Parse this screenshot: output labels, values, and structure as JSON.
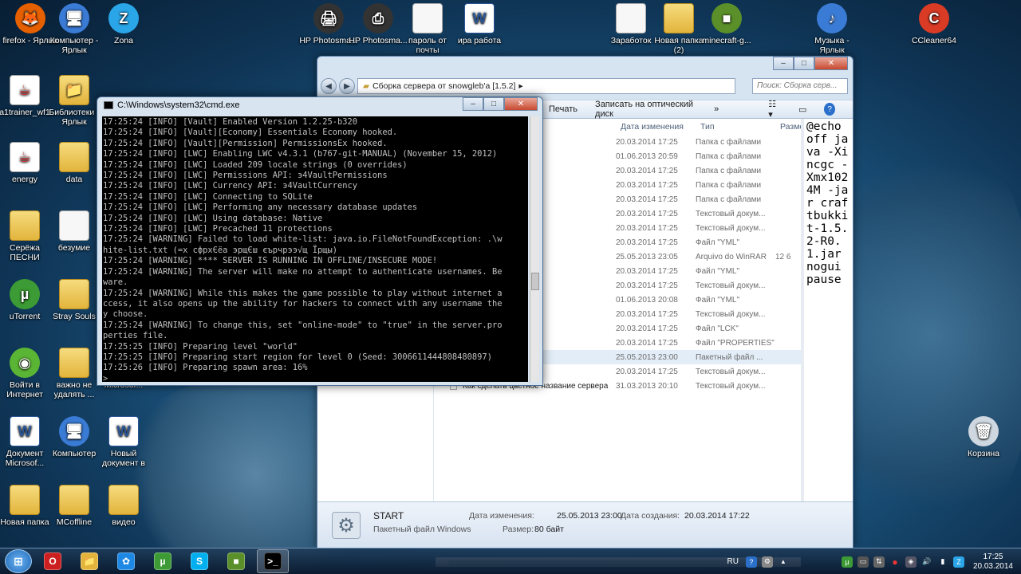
{
  "desktop": {
    "icons": [
      {
        "label": "firefox - Ярлык",
        "glyph": "🦊",
        "kind": "app",
        "color": "#e66000"
      },
      {
        "label": "Компьютер - Ярлык",
        "glyph": "🖥",
        "kind": "app",
        "color": "#3a7bd5"
      },
      {
        "label": "Zona",
        "glyph": "Z",
        "kind": "app",
        "color": "#2aa6e8"
      },
      {
        "label": "a1trainer_wf1",
        "glyph": "☕",
        "kind": "jar",
        "color": "#ffffff"
      },
      {
        "label": "Библиотеки - Ярлык",
        "glyph": "📁",
        "kind": "folder",
        "color": "#e2b43c"
      },
      {
        "label": "energy",
        "glyph": "☕",
        "kind": "jar",
        "color": "#ffffff"
      },
      {
        "label": "data",
        "glyph": "",
        "kind": "folder",
        "color": "#e2b43c"
      },
      {
        "label": "Серёжа ПЕСНИ",
        "glyph": "",
        "kind": "folder",
        "color": "#e2b43c"
      },
      {
        "label": "безумие",
        "glyph": "",
        "kind": "file",
        "color": "#f7f7f7"
      },
      {
        "label": "uTorrent",
        "glyph": "µ",
        "kind": "app",
        "color": "#3c9b35"
      },
      {
        "label": "Stray Souls",
        "glyph": "",
        "kind": "folder",
        "color": "#e2b43c"
      },
      {
        "label": "Войти в Интернет",
        "glyph": "◉",
        "kind": "app",
        "color": "#5bb535"
      },
      {
        "label": "важно не удалять ...",
        "glyph": "",
        "kind": "folder",
        "color": "#e2b43c"
      },
      {
        "label": "Microsof...",
        "glyph": "",
        "kind": "folder",
        "color": "#e2b43c"
      },
      {
        "label": "Документ Microsof...",
        "glyph": "W",
        "kind": "word",
        "color": "#2b5797"
      },
      {
        "label": "Компьютер",
        "glyph": "🖥",
        "kind": "app",
        "color": "#3a7bd5"
      },
      {
        "label": "Новый документ в",
        "glyph": "W",
        "kind": "word",
        "color": "#2b5797"
      },
      {
        "label": "Новая папка",
        "glyph": "",
        "kind": "folder",
        "color": "#e2b43c"
      },
      {
        "label": "MCoffline",
        "glyph": "",
        "kind": "folder",
        "color": "#e2b43c"
      },
      {
        "label": "видео",
        "glyph": "",
        "kind": "folder",
        "color": "#e2b43c"
      },
      {
        "label": "HP Photosma...",
        "glyph": "🖨",
        "kind": "app",
        "color": "#333333"
      },
      {
        "label": "HP Photosma...",
        "glyph": "⎙",
        "kind": "app",
        "color": "#333333"
      },
      {
        "label": "пароль от почты",
        "glyph": "",
        "kind": "file",
        "color": "#f7f7f7"
      },
      {
        "label": "ира работа",
        "glyph": "W",
        "kind": "word",
        "color": "#2b5797"
      },
      {
        "label": "Заработок",
        "glyph": "",
        "kind": "file",
        "color": "#f7f7f7"
      },
      {
        "label": "Новая папка (2)",
        "glyph": "",
        "kind": "folder",
        "color": "#e2b43c"
      },
      {
        "label": "minecraft-g...",
        "glyph": "■",
        "kind": "app",
        "color": "#5a8f29"
      },
      {
        "label": "Музыка - Ярлык",
        "glyph": "♪",
        "kind": "app",
        "color": "#3a7bd5"
      },
      {
        "label": "CCleaner64",
        "glyph": "C",
        "kind": "app",
        "color": "#d93b25"
      },
      {
        "label": "Корзина",
        "glyph": "🗑",
        "kind": "app",
        "color": "#cfd8e0"
      }
    ]
  },
  "explorer": {
    "breadcrumb": "Сборка сервера от snowgleb'a [1.5.2]",
    "search_placeholder": "Поиск: Сборка серв...",
    "toolbar": [
      "Печать",
      "Записать на оптический диск",
      "»"
    ],
    "columns": {
      "date": "Дата изменения",
      "type": "Тип",
      "size": "Разме"
    },
    "files": [
      {
        "name": "",
        "date": "20.03.2014 17:25",
        "type": "Папка с файлами",
        "size": ""
      },
      {
        "name": "",
        "date": "01.06.2013 20:59",
        "type": "Папка с файлами",
        "size": ""
      },
      {
        "name": "",
        "date": "20.03.2014 17:25",
        "type": "Папка с файлами",
        "size": ""
      },
      {
        "name": "",
        "date": "20.03.2014 17:25",
        "type": "Папка с файлами",
        "size": ""
      },
      {
        "name": "",
        "date": "20.03.2014 17:25",
        "type": "Папка с файлами",
        "size": ""
      },
      {
        "name": "",
        "date": "20.03.2014 17:25",
        "type": "Текстовый докум...",
        "size": ""
      },
      {
        "name": "",
        "date": "20.03.2014 17:25",
        "type": "Текстовый докум...",
        "size": ""
      },
      {
        "name": "",
        "date": "20.03.2014 17:25",
        "type": "Файл \"YML\"",
        "size": ""
      },
      {
        "name": "",
        "date": "25.05.2013 23:05",
        "type": "Arquivo do WinRAR",
        "size": "12 6"
      },
      {
        "name": "",
        "date": "20.03.2014 17:25",
        "type": "Файл \"YML\"",
        "size": ""
      },
      {
        "name": "",
        "date": "20.03.2014 17:25",
        "type": "Текстовый докум...",
        "size": ""
      },
      {
        "name": "",
        "date": "01.06.2013 20:08",
        "type": "Файл \"YML\"",
        "size": ""
      },
      {
        "name": "",
        "date": "20.03.2014 17:25",
        "type": "Текстовый докум...",
        "size": ""
      },
      {
        "name": "",
        "date": "20.03.2014 17:25",
        "type": "Файл \"LCK\"",
        "size": ""
      },
      {
        "name": "",
        "date": "20.03.2014 17:25",
        "type": "Файл \"PROPERTIES\"",
        "size": ""
      },
      {
        "name": "",
        "date": "25.05.2013 23:00",
        "type": "Пакетный файл ...",
        "size": "",
        "selected": true
      },
      {
        "name": "",
        "date": "20.03.2014 17:25",
        "type": "Текстовый докум...",
        "size": ""
      },
      {
        "name": "Как сделать цветное название сервера",
        "date": "31.03.2013 20:10",
        "type": "Текстовый докум...",
        "size": ""
      }
    ],
    "preview_text": "@echo off java -Xincgc -Xmx1024M -jar craftbukkit-1.5.2-R0.1.jar nogui pause",
    "details": {
      "name": "START",
      "kind": "Пакетный файл Windows",
      "modified_label": "Дата изменения:",
      "modified": "25.05.2013 23:00",
      "created_label": "Дата создания:",
      "created": "20.03.2014 17:22",
      "size_label": "Размер:",
      "size": "80 байт"
    }
  },
  "cmd": {
    "title": "C:\\Windows\\system32\\cmd.exe",
    "lines": [
      "17:25:24 [INFO] [Vault] Enabled Version 1.2.25-b320",
      "17:25:24 [INFO] [Vault][Economy] Essentials Economy hooked.",
      "17:25:24 [INFO] [Vault][Permission] PermissionsEx hooked.",
      "17:25:24 [INFO] [LWC] Enabling LWC v4.3.1 (b767-git-MANUAL) (November 15, 2012)",
      "17:25:24 [INFO] [LWC] Loaded 209 locale strings (0 overrides)",
      "17:25:24 [INFO] [LWC] Permissions API: э4VaultPermissions",
      "17:25:24 [INFO] [LWC] Currency API: э4VaultCurrency",
      "17:25:24 [INFO] [LWC] Connecting to SQLite",
      "17:25:24 [INFO] [LWC] Performing any necessary database updates",
      "17:25:24 [INFO] [LWC] Using database: Native",
      "17:25:24 [INFO] [LWC] Precached 11 protections",
      "17:25:24 [WARNING] Failed to load white-list: java.io.FileNotFoundException: .\\w",
      "hite-list.txt (=х сфрхЄёа эрщЄш єърчрээ√щ Їрщы)",
      "17:25:24 [WARNING] **** SERVER IS RUNNING IN OFFLINE/INSECURE MODE!",
      "17:25:24 [WARNING] The server will make no attempt to authenticate usernames. Be",
      "ware.",
      "17:25:24 [WARNING] While this makes the game possible to play without internet a",
      "ccess, it also opens up the ability for hackers to connect with any username the",
      "y choose.",
      "17:25:24 [WARNING] To change this, set \"online-mode\" to \"true\" in the server.pro",
      "perties file.",
      "17:25:25 [INFO] Preparing level \"world\"",
      "17:25:25 [INFO] Preparing start region for level 0 (Seed: 3006611444808480897)",
      "17:25:26 [INFO] Preparing spawn area: 16%",
      ">"
    ]
  },
  "taskbar": {
    "items": [
      {
        "name": "opera",
        "glyph": "O",
        "color": "#cc1f1f"
      },
      {
        "name": "explorer",
        "glyph": "📁",
        "color": "#e2b43c"
      },
      {
        "name": "media",
        "glyph": "✿",
        "color": "#1e88e5"
      },
      {
        "name": "utorrent",
        "glyph": "µ",
        "color": "#3c9b35"
      },
      {
        "name": "skype",
        "glyph": "S",
        "color": "#00aff0"
      },
      {
        "name": "minecraft",
        "glyph": "■",
        "color": "#5a8f29"
      },
      {
        "name": "cmd",
        "glyph": ">_",
        "color": "#000000",
        "active": true
      }
    ],
    "lang": "RU",
    "time": "17:25",
    "date": "20.03.2014"
  }
}
